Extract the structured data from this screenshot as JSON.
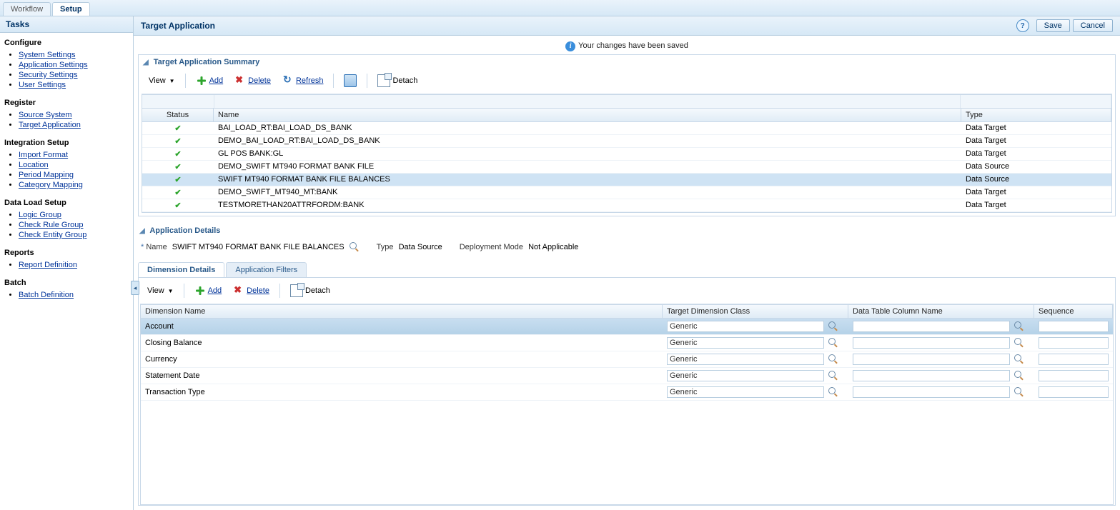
{
  "page_tabs": {
    "workflow": "Workflow",
    "setup": "Setup"
  },
  "sidebar": {
    "title": "Tasks",
    "groups": [
      {
        "title": "Configure",
        "items": [
          "System Settings",
          "Application Settings",
          "Security Settings",
          "User Settings"
        ]
      },
      {
        "title": "Register",
        "items": [
          "Source System",
          "Target Application"
        ]
      },
      {
        "title": "Integration Setup",
        "items": [
          "Import Format",
          "Location",
          "Period Mapping",
          "Category Mapping"
        ]
      },
      {
        "title": "Data Load Setup",
        "items": [
          "Logic Group",
          "Check Rule Group",
          "Check Entity Group"
        ]
      },
      {
        "title": "Reports",
        "items": [
          "Report Definition"
        ]
      },
      {
        "title": "Batch",
        "items": [
          "Batch Definition"
        ]
      }
    ]
  },
  "main": {
    "title": "Target Application",
    "save": "Save",
    "cancel": "Cancel",
    "info_msg": "Your changes have been saved"
  },
  "summary": {
    "title": "Target Application Summary",
    "toolbar": {
      "view": "View",
      "add": "Add",
      "delete": "Delete",
      "refresh": "Refresh",
      "detach": "Detach"
    },
    "columns": {
      "status": "Status",
      "name": "Name",
      "type": "Type"
    },
    "rows": [
      {
        "status": "ok",
        "name": "BAI_LOAD_RT:BAI_LOAD_DS_BANK",
        "type": "Data Target",
        "selected": false
      },
      {
        "status": "ok",
        "name": "DEMO_BAI_LOAD_RT:BAI_LOAD_DS_BANK",
        "type": "Data Target",
        "selected": false
      },
      {
        "status": "ok",
        "name": "GL POS BANK:GL",
        "type": "Data Target",
        "selected": false
      },
      {
        "status": "ok",
        "name": "DEMO_SWIFT MT940 FORMAT BANK FILE",
        "type": "Data Source",
        "selected": false
      },
      {
        "status": "ok",
        "name": "SWIFT MT940 FORMAT BANK FILE BALANCES",
        "type": "Data Source",
        "selected": true
      },
      {
        "status": "ok",
        "name": "DEMO_SWIFT_MT940_MT:BANK",
        "type": "Data Target",
        "selected": false
      },
      {
        "status": "ok",
        "name": "TESTMORETHAN20ATTRFORDM:BANK",
        "type": "Data Target",
        "selected": false
      }
    ]
  },
  "details": {
    "title": "Application Details",
    "labels": {
      "name": "Name",
      "type": "Type",
      "deploy": "Deployment Mode"
    },
    "name": "SWIFT MT940 FORMAT BANK FILE BALANCES",
    "type": "Data Source",
    "deploy": "Not Applicable",
    "tabs": {
      "dim": "Dimension Details",
      "filters": "Application Filters"
    },
    "dim_toolbar": {
      "view": "View",
      "add": "Add",
      "delete": "Delete",
      "detach": "Detach"
    },
    "dim_columns": {
      "name": "Dimension Name",
      "class": "Target Dimension Class",
      "dt": "Data Table Column Name",
      "seq": "Sequence"
    },
    "dim_rows": [
      {
        "name": "Account",
        "class": "Generic",
        "dt": "",
        "seq": "",
        "selected": true
      },
      {
        "name": "Closing Balance",
        "class": "Generic",
        "dt": "",
        "seq": "",
        "selected": false
      },
      {
        "name": "Currency",
        "class": "Generic",
        "dt": "",
        "seq": "",
        "selected": false
      },
      {
        "name": "Statement Date",
        "class": "Generic",
        "dt": "",
        "seq": "",
        "selected": false
      },
      {
        "name": "Transaction Type",
        "class": "Generic",
        "dt": "",
        "seq": "",
        "selected": false
      }
    ]
  }
}
